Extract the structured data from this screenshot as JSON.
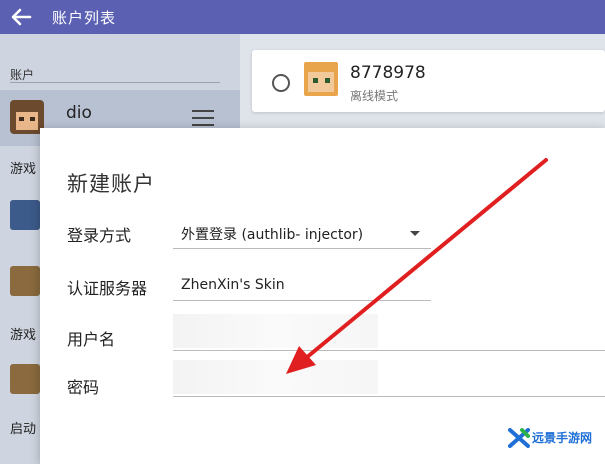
{
  "header": {
    "title": "账户列表"
  },
  "sidebar": {
    "heading": "账户",
    "account": {
      "name": "dio"
    },
    "stubs": [
      "游戏",
      "游戏",
      "启动"
    ]
  },
  "account_card": {
    "name": "8778978",
    "status": "离线模式"
  },
  "dialog": {
    "title": "新建账户",
    "login_method": {
      "label": "登录方式",
      "value": "外置登录 (authlib- injector)"
    },
    "auth_server": {
      "label": "认证服务器",
      "value": "ZhenXin's Skin"
    },
    "username": {
      "label": "用户名",
      "value": ""
    },
    "password": {
      "label": "密码",
      "value": ""
    }
  },
  "watermark": {
    "text": "远景手游网"
  },
  "colors": {
    "topbar": "#5b60b3",
    "arrow": "#e02020",
    "watermark": "#1f6fd6"
  }
}
